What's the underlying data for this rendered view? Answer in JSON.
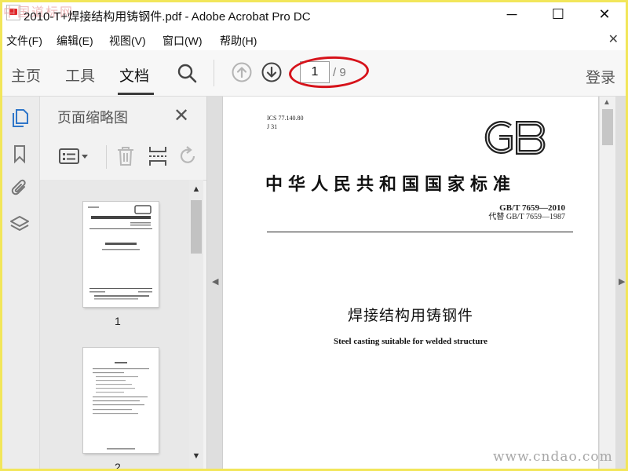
{
  "window": {
    "title": "2010-T+焊接结构用铸钢件.pdf - Adobe Acrobat Pro DC",
    "watermark_top": "中国道标网",
    "minimize": "─",
    "maximize": "☐",
    "close": "✕"
  },
  "menu": {
    "items": [
      "文件(F)",
      "编辑(E)",
      "视图(V)",
      "窗口(W)",
      "帮助(H)"
    ],
    "close": "✕"
  },
  "toolbar": {
    "tabs": [
      "主页",
      "工具",
      "文档"
    ],
    "active_tab": "文档",
    "page_current": "1",
    "page_total": "/ 9",
    "login": "登录"
  },
  "thumbnail_panel": {
    "title": "页面缩略图",
    "close": "✕",
    "thumbnails": [
      {
        "label": "1"
      },
      {
        "label": "2"
      }
    ]
  },
  "document": {
    "ics": "ICS 77.140.80",
    "ccs": "J 31",
    "standard_title": "中华人民共和国国家标准",
    "gb_number": "GB/T 7659—2010",
    "replaces": "代替 GB/T 7659—1987",
    "cn_title": "焊接结构用铸钢件",
    "en_title": "Steel casting suitable for welded structure"
  },
  "watermark_bottom": "www.cndao.com",
  "colors": {
    "accent_blue": "#2f76c9",
    "annotation_red": "#d6121a",
    "frame_yellow": "#f2e65a"
  }
}
